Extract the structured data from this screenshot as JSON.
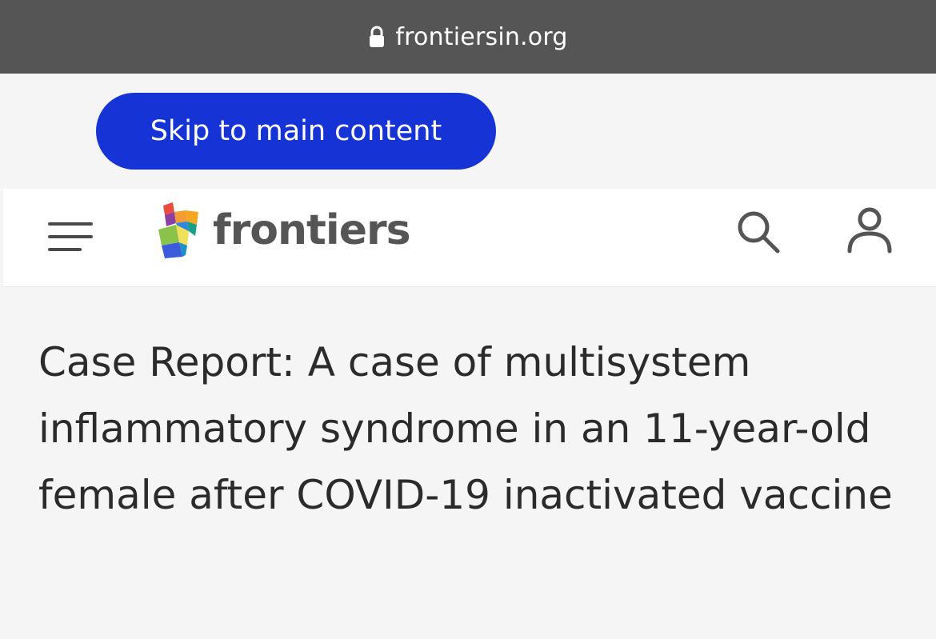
{
  "browser": {
    "url": "frontiersin.org",
    "icon": "lock-icon"
  },
  "skip_link": {
    "label": "Skip to main content",
    "color": "#1634d6"
  },
  "header": {
    "menu_icon": "hamburger-menu-icon",
    "logo_text": "frontiers",
    "search_icon": "search-icon",
    "account_icon": "user-account-icon"
  },
  "article": {
    "title": "Case Report: A case of multisystem inflammatory syndrome in an 11-year-old female after COVID-19 inactivated vaccine"
  }
}
